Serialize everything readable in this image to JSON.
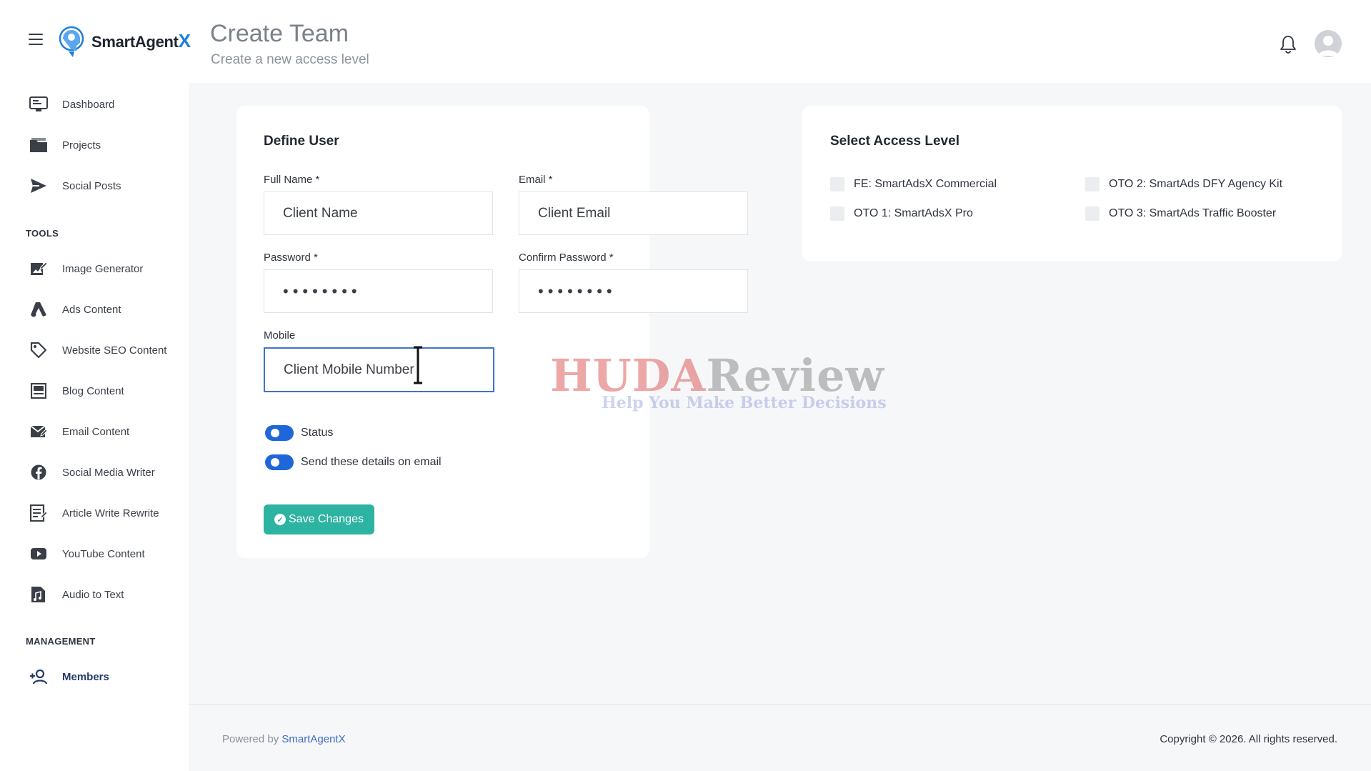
{
  "header": {
    "logo_text": "SmartAgent",
    "logo_accent": "X",
    "title": "Create Team",
    "subtitle": "Create a new access level"
  },
  "sidebar": {
    "main_items": [
      {
        "label": "Dashboard",
        "icon": "monitor-icon"
      },
      {
        "label": "Projects",
        "icon": "folder-icon"
      },
      {
        "label": "Social Posts",
        "icon": "send-icon"
      }
    ],
    "tools_label": "TOOLS",
    "tools": [
      {
        "label": "Image Generator",
        "icon": "image-edit-icon"
      },
      {
        "label": "Ads Content",
        "icon": "ads-icon"
      },
      {
        "label": "Website SEO Content",
        "icon": "tag-icon"
      },
      {
        "label": "Blog Content",
        "icon": "blog-icon"
      },
      {
        "label": "Email Content",
        "icon": "mail-edit-icon"
      },
      {
        "label": "Social Media Writer",
        "icon": "facebook-icon"
      },
      {
        "label": "Article Write Rewrite",
        "icon": "article-icon"
      },
      {
        "label": "YouTube Content",
        "icon": "youtube-icon"
      },
      {
        "label": "Audio to Text",
        "icon": "audio-file-icon"
      }
    ],
    "management_label": "MANAGEMENT",
    "management": [
      {
        "label": "Members",
        "icon": "add-user-icon",
        "active": true
      }
    ]
  },
  "define_user": {
    "title": "Define User",
    "full_name": {
      "label": "Full Name *",
      "value": "Client Name"
    },
    "email": {
      "label": "Email *",
      "value": "Client Email"
    },
    "password": {
      "label": "Password *",
      "value": "••••••••"
    },
    "confirm_password": {
      "label": "Confirm Password *",
      "value": "••••••••"
    },
    "mobile": {
      "label": "Mobile",
      "value": "Client Mobile Number"
    },
    "toggles": [
      {
        "label": "Status",
        "on": true
      },
      {
        "label": "Send these details on email",
        "on": true
      }
    ],
    "save_label": "Save Changes"
  },
  "access_level": {
    "title": "Select Access Level",
    "options": [
      {
        "label": "FE: SmartAdsX Commercial",
        "checked": false
      },
      {
        "label": "OTO 2: SmartAds DFY Agency Kit",
        "checked": false
      },
      {
        "label": "OTO 1: SmartAdsX Pro",
        "checked": false
      },
      {
        "label": "OTO 3: SmartAds Traffic Booster",
        "checked": false
      }
    ]
  },
  "footer": {
    "powered_prefix": "Powered by ",
    "powered_brand": "SmartAgentX",
    "copyright": "Copyright © 2026. All rights reserved."
  },
  "watermark": {
    "main_a": "HUDA",
    "main_b": "Review",
    "tagline": "Help You Make Better Decisions"
  },
  "colors": {
    "accent_blue": "#1f66d9",
    "save_button": "#2cb3a2",
    "focus_border": "#3f74c9",
    "logo_x": "#1e7fd9"
  }
}
